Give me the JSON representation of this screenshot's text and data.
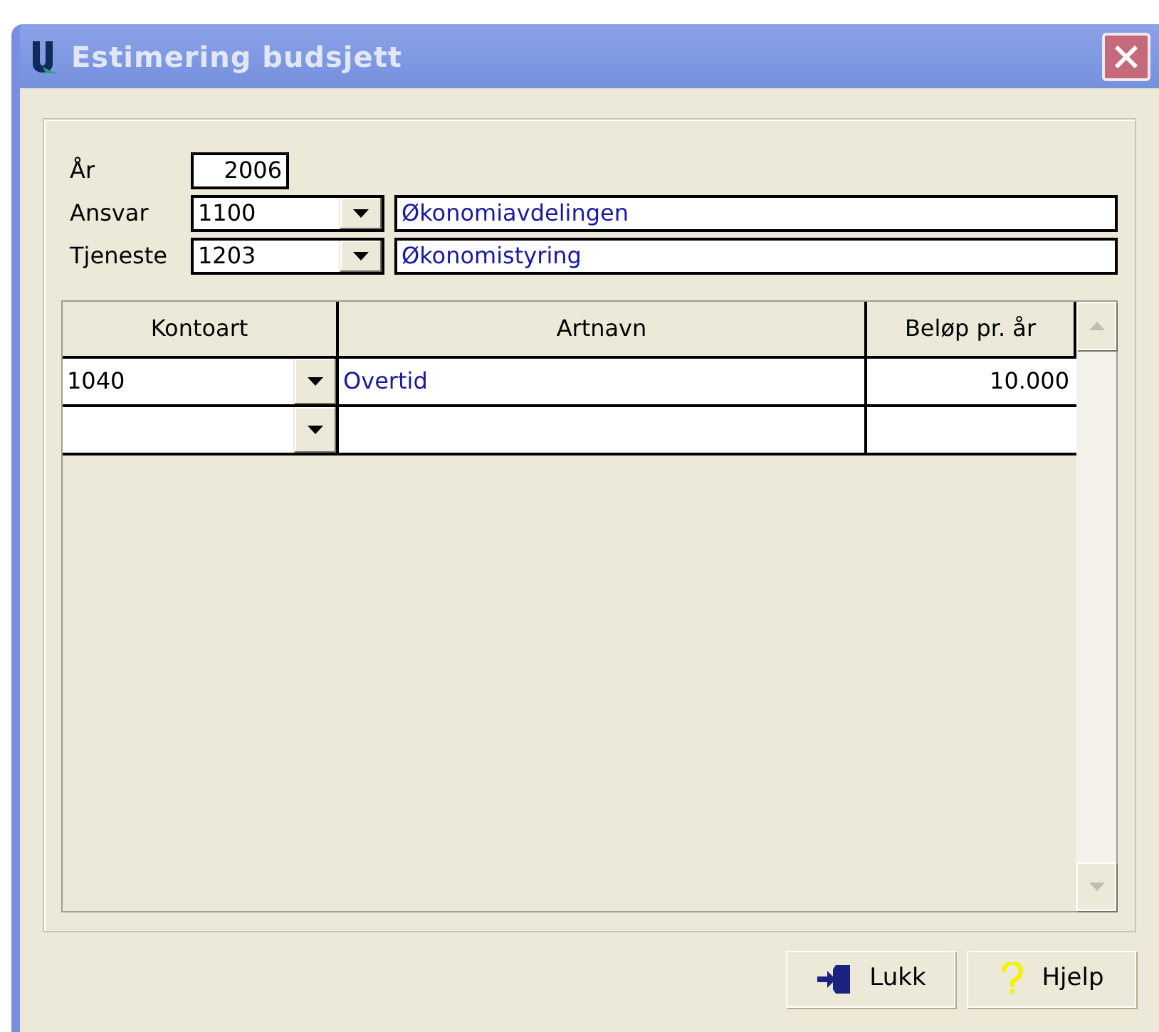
{
  "window": {
    "title": "Estimering budsjett"
  },
  "fields": {
    "year": {
      "label": "År",
      "value": "2006"
    },
    "ansvar": {
      "label": "Ansvar",
      "code": "1100",
      "name": "Økonomiavdelingen"
    },
    "tjeneste": {
      "label": "Tjeneste",
      "code": "1203",
      "name": "Økonomistyring"
    }
  },
  "table": {
    "columns": [
      "Kontoart",
      "Artnavn",
      "Beløp pr. år"
    ],
    "rows": [
      {
        "kind": "entry",
        "kontoart": "1040",
        "artnavn": "Overtid",
        "belop": "10.000"
      },
      {
        "kind": "blank"
      }
    ]
  },
  "buttons": [
    {
      "kind": "close",
      "label": "Lukk"
    },
    {
      "kind": "help",
      "label": "Hjelp"
    }
  ]
}
